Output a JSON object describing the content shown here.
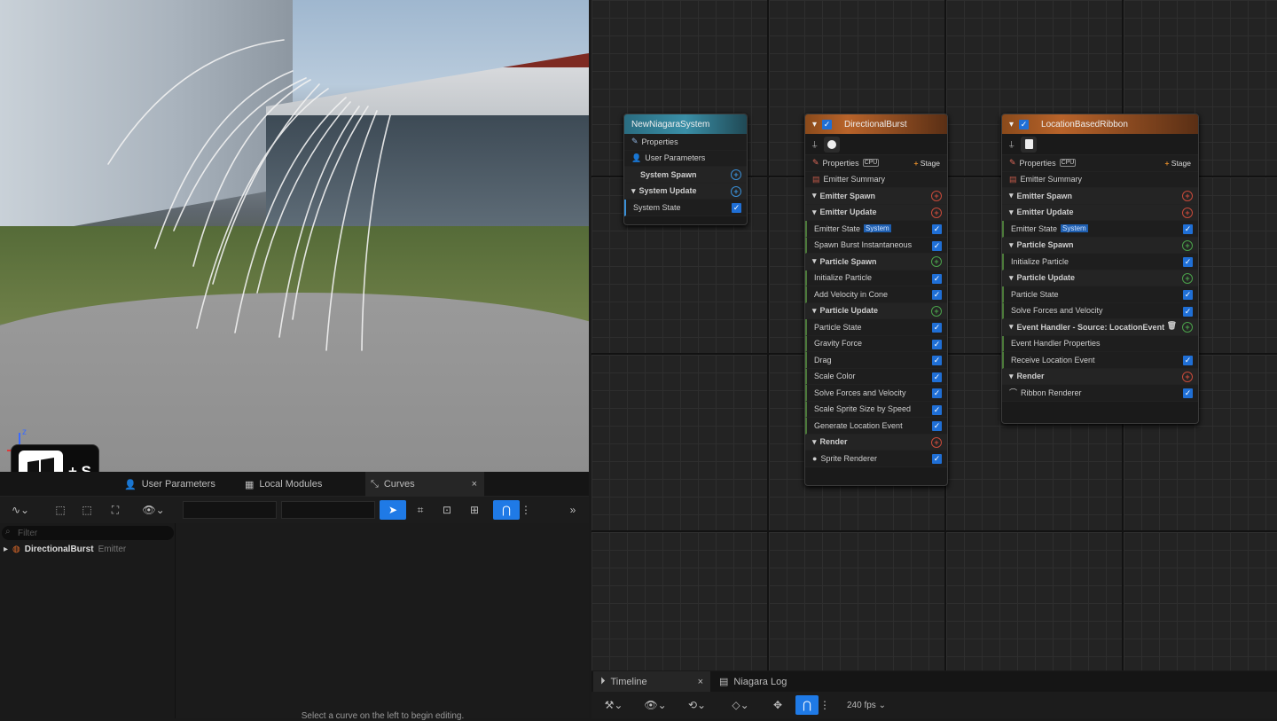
{
  "viewport": {
    "axis_label": "z"
  },
  "keyboard_overlay": {
    "key_plus": "+",
    "key": "S"
  },
  "bottom_left_tabs": [
    {
      "label": "User Parameters",
      "icon": "user-icon"
    },
    {
      "label": "Local Modules",
      "icon": "module-icon"
    },
    {
      "label": "Curves",
      "icon": "curve-icon",
      "close": "×"
    }
  ],
  "tree": {
    "filter_placeholder": "Filter",
    "items": [
      {
        "name": "DirectionalBurst",
        "type": "Emitter"
      }
    ]
  },
  "curves": {
    "hint": "Select a curve on the left to begin editing."
  },
  "system_node": {
    "title": "NewNiagaraSystem",
    "rows": [
      "Properties",
      "User Parameters",
      "System Spawn",
      "System Update",
      "System State"
    ]
  },
  "burst_node": {
    "title": "DirectionalBurst",
    "properties": "Properties",
    "stage": "Stage",
    "summary": "Emitter Summary",
    "rows": [
      {
        "label": "Emitter Spawn",
        "kind": "sec",
        "btn": "r"
      },
      {
        "label": "Emitter Update",
        "kind": "sec",
        "btn": "r"
      },
      {
        "label": "Emitter State",
        "tag": "System",
        "kind": "mod"
      },
      {
        "label": "Spawn Burst Instantaneous",
        "kind": "mod"
      },
      {
        "label": "Particle Spawn",
        "kind": "sec",
        "btn": "g"
      },
      {
        "label": "Initialize Particle",
        "kind": "mod"
      },
      {
        "label": "Add Velocity in Cone",
        "kind": "mod"
      },
      {
        "label": "Particle Update",
        "kind": "sec",
        "btn": "g"
      },
      {
        "label": "Particle State",
        "kind": "mod"
      },
      {
        "label": "Gravity Force",
        "kind": "mod"
      },
      {
        "label": "Drag",
        "kind": "mod"
      },
      {
        "label": "Scale Color",
        "kind": "mod"
      },
      {
        "label": "Solve Forces and Velocity",
        "kind": "mod"
      },
      {
        "label": "Scale Sprite Size by Speed",
        "kind": "mod"
      },
      {
        "label": "Generate Location Event",
        "kind": "mod"
      },
      {
        "label": "Render",
        "kind": "sec",
        "btn": "r"
      },
      {
        "label": "Sprite Renderer",
        "kind": "plain"
      }
    ]
  },
  "ribbon_node": {
    "title": "LocationBasedRibbon",
    "properties": "Properties",
    "stage": "Stage",
    "summary": "Emitter Summary",
    "rows": [
      {
        "label": "Emitter Spawn",
        "kind": "sec",
        "btn": "r"
      },
      {
        "label": "Emitter Update",
        "kind": "sec",
        "btn": "r"
      },
      {
        "label": "Emitter State",
        "tag": "System",
        "kind": "mod"
      },
      {
        "label": "Particle Spawn",
        "kind": "sec",
        "btn": "g"
      },
      {
        "label": "Initialize Particle",
        "kind": "mod"
      },
      {
        "label": "Particle Update",
        "kind": "sec",
        "btn": "g"
      },
      {
        "label": "Particle State",
        "kind": "mod"
      },
      {
        "label": "Solve Forces and Velocity",
        "kind": "mod"
      },
      {
        "label": "Event Handler - Source: LocationEvent",
        "kind": "sec",
        "btn": "g"
      },
      {
        "label": "Event Handler Properties",
        "kind": "mod"
      },
      {
        "label": "Receive Location Event",
        "kind": "mod"
      },
      {
        "label": "Render",
        "kind": "sec",
        "btn": "r"
      },
      {
        "label": "Ribbon Renderer",
        "kind": "plain"
      }
    ]
  },
  "bottom_right_tabs": [
    {
      "label": "Timeline",
      "close": "×"
    },
    {
      "label": "Niagara Log"
    }
  ],
  "timeline_toolbar": {
    "fps": "240 fps"
  }
}
